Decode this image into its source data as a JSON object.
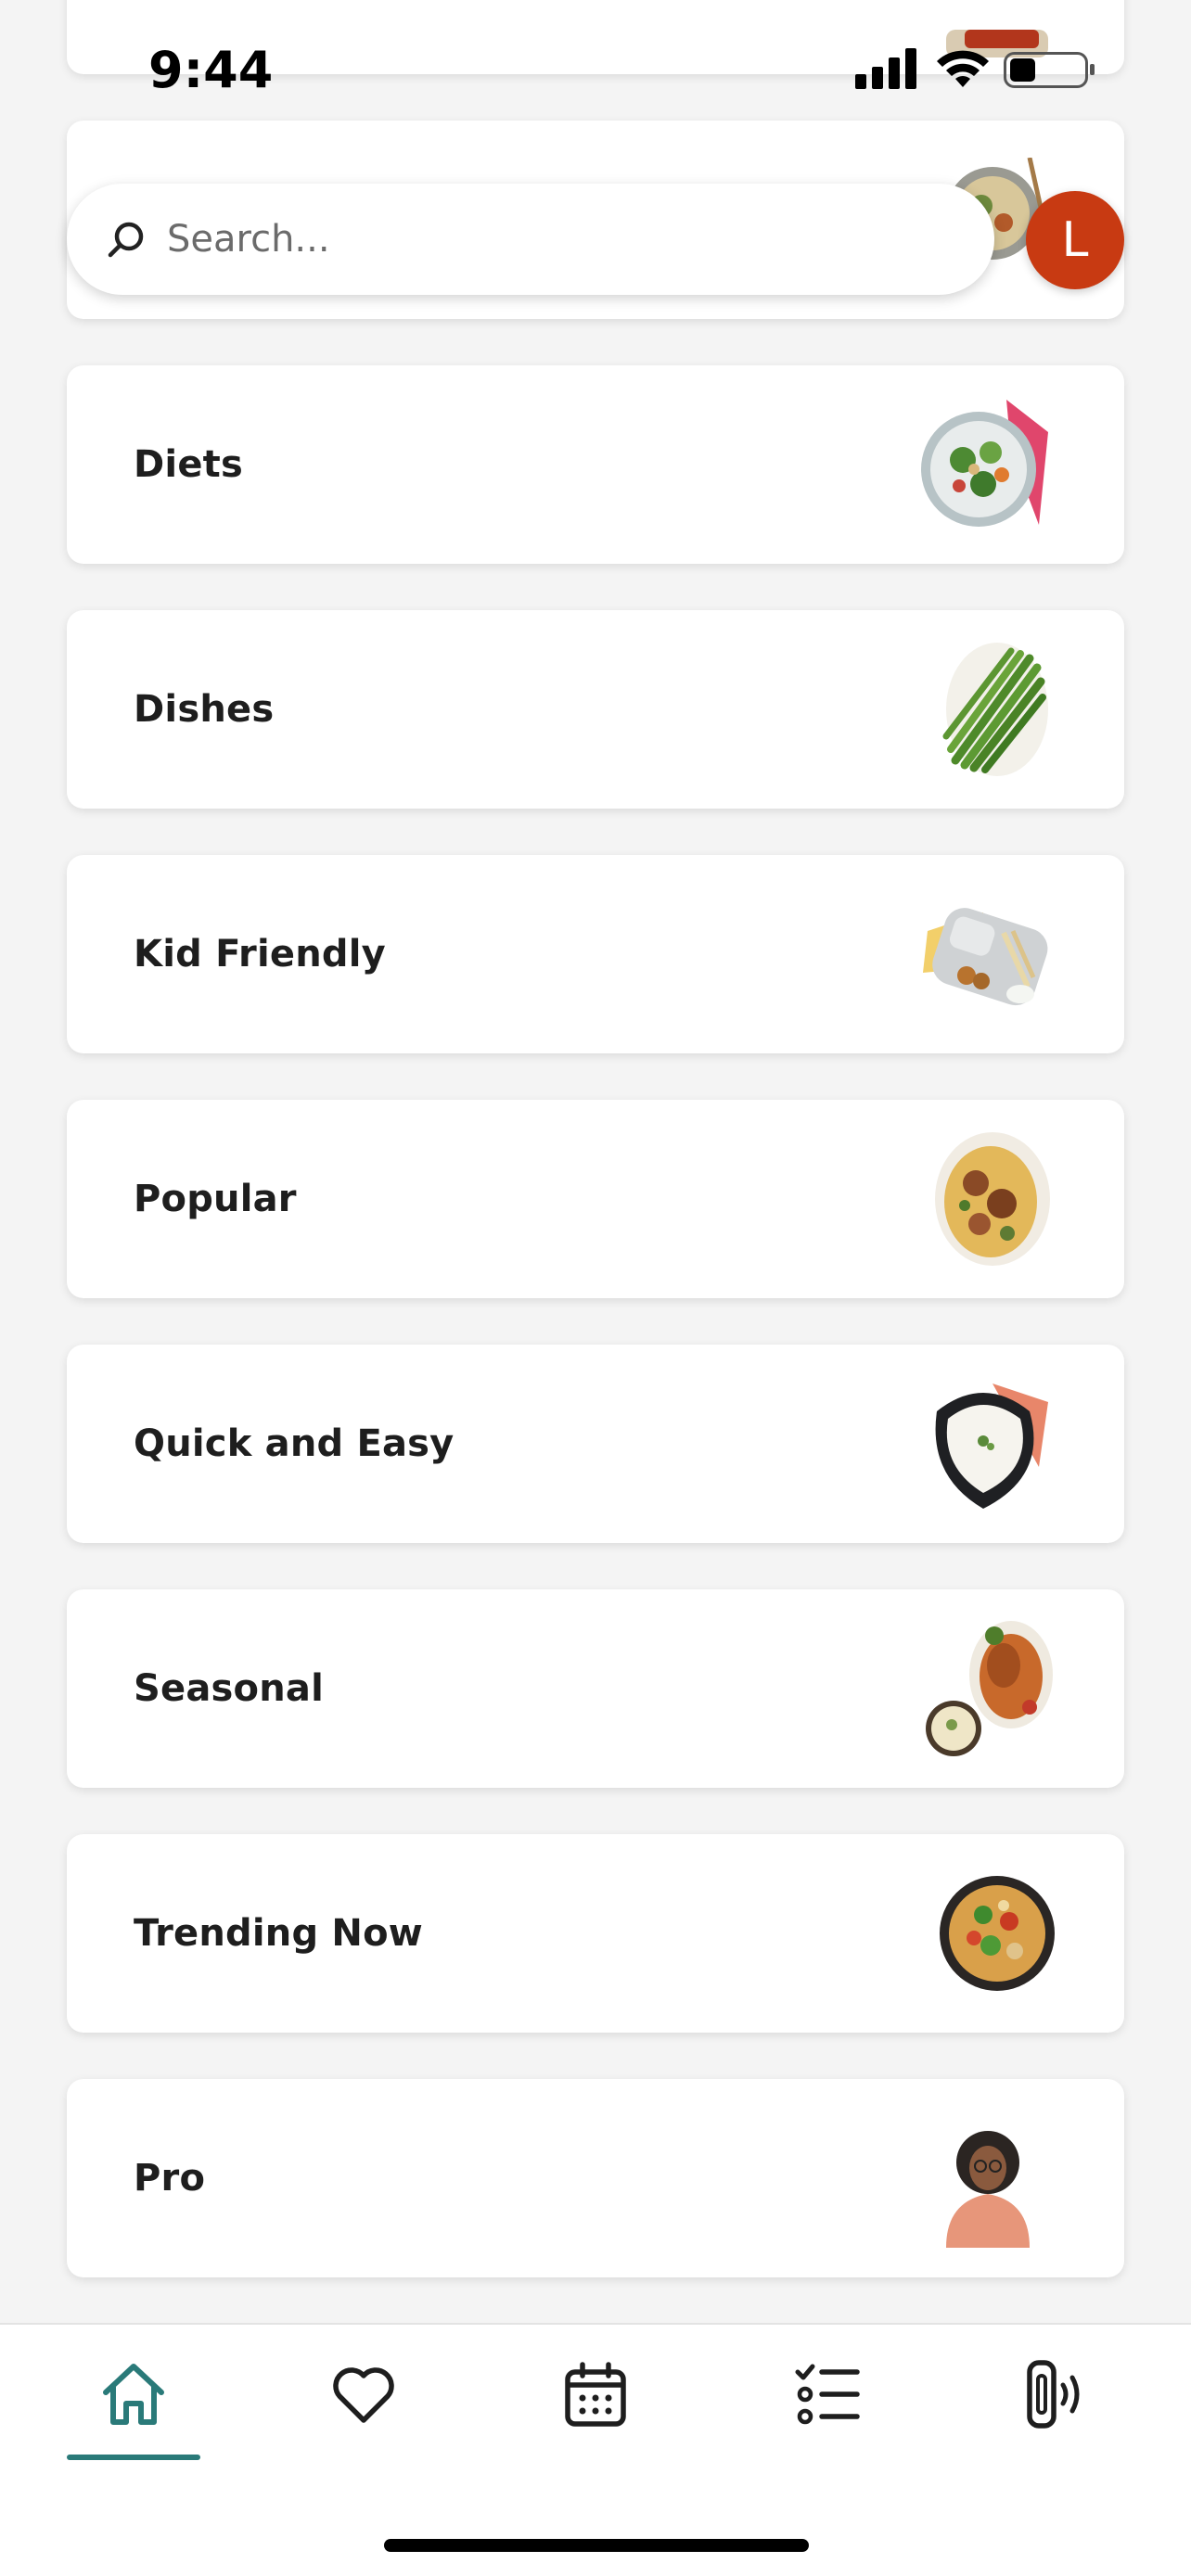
{
  "status_bar": {
    "time": "9:44",
    "battery_level": 0.35
  },
  "search": {
    "placeholder": "Search..."
  },
  "avatar": {
    "initial": "L",
    "color": "#c83a12"
  },
  "categories": [
    {
      "label": "Diets"
    },
    {
      "label": "Dishes"
    },
    {
      "label": "Kid Friendly"
    },
    {
      "label": "Popular"
    },
    {
      "label": "Quick and Easy"
    },
    {
      "label": "Seasonal"
    },
    {
      "label": "Trending Now"
    },
    {
      "label": "Pro"
    }
  ],
  "tabs": [
    {
      "name": "home-icon",
      "active": true
    },
    {
      "name": "heart-icon",
      "active": false
    },
    {
      "name": "calendar-icon",
      "active": false
    },
    {
      "name": "checklist-icon",
      "active": false
    },
    {
      "name": "appliance-icon",
      "active": false
    }
  ],
  "colors": {
    "accent": "#2a7a79",
    "avatar": "#c83a12"
  }
}
